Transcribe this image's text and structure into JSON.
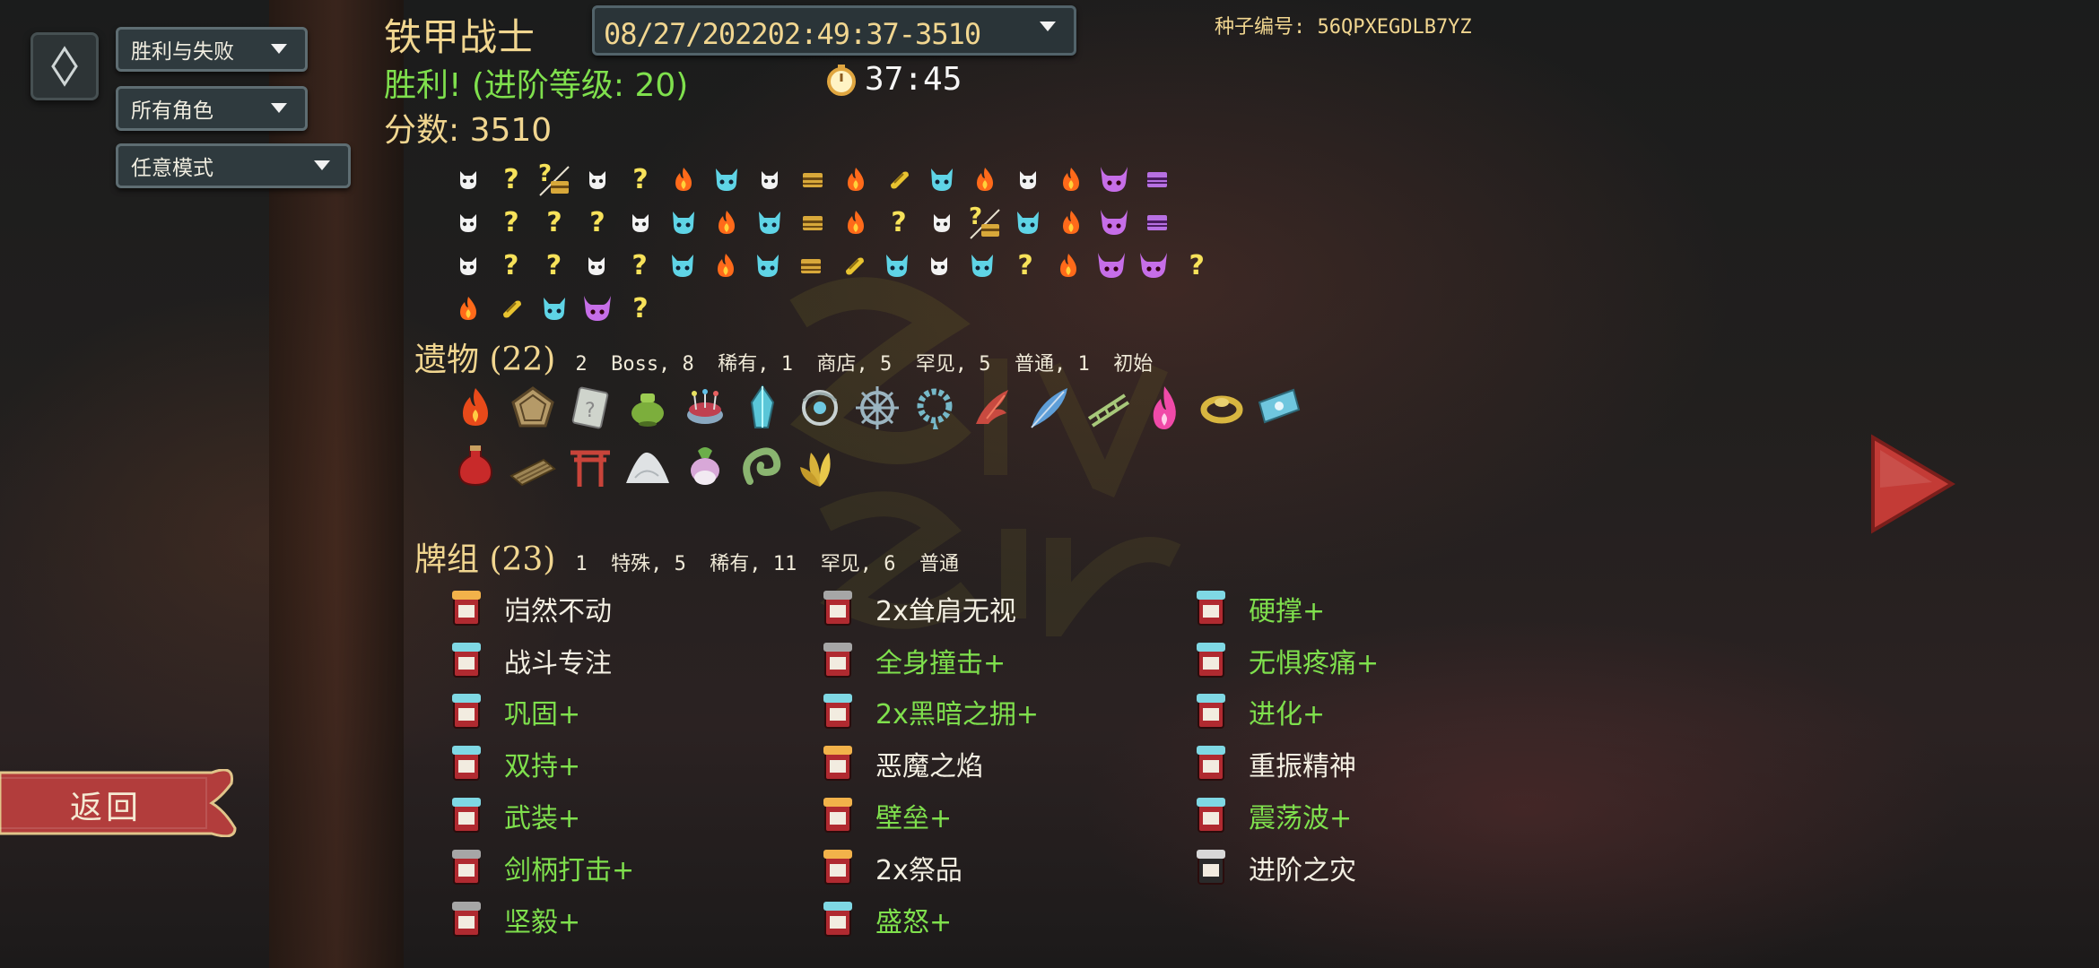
{
  "header": {
    "character": "铁甲战士",
    "run_select": "08/27/202202:49:37-3510",
    "seed": "种子编号: 56QPXEGDLB7YZ",
    "result": "胜利! (进阶等级: 20)",
    "time": "37:45",
    "score": "分数: 3510"
  },
  "filters": {
    "outcome": "胜利与失败",
    "character": "所有角色",
    "mode": "任意模式"
  },
  "back_label": "返回",
  "path": [
    [
      "monster",
      "question",
      "question-chest",
      "monster",
      "question",
      "rest",
      "elite",
      "monster",
      "shop",
      "rest",
      "treasure",
      "elite",
      "rest",
      "monster",
      "rest",
      "boss",
      "chest"
    ],
    [
      "monster",
      "question",
      "question",
      "question",
      "monster",
      "elite",
      "rest",
      "elite",
      "shop",
      "rest",
      "question",
      "monster",
      "question-chest",
      "elite",
      "rest",
      "boss",
      "chest"
    ],
    [
      "monster",
      "question",
      "question",
      "monster",
      "question",
      "elite",
      "rest",
      "elite",
      "shop",
      "treasure",
      "elite",
      "monster",
      "elite",
      "question",
      "rest",
      "boss",
      "boss",
      "question"
    ],
    [
      "rest",
      "treasure",
      "elite",
      "boss",
      "question"
    ]
  ],
  "relics": {
    "title": "遗物 (22)",
    "summary": "2  Boss, 8  稀有, 1  商店, 5  罕见, 5  普通, 1  初始",
    "row1": [
      "burning-blood",
      "pentagon-relic",
      "question-card",
      "green-pot",
      "pincushion",
      "blue-crystal",
      "orb-swirl",
      "ship-wheel",
      "prayer-beads",
      "red-claw",
      "blue-feather",
      "green-ladder",
      "pink-flame",
      "gold-ring",
      "blue-ticket"
    ],
    "row2": [
      "red-potion",
      "wooden-board",
      "torii-gate",
      "salt-pile",
      "turnip",
      "green-snake",
      "golden-leaves"
    ]
  },
  "deck": {
    "title": "牌组 (23)",
    "summary": "1  特殊, 5  稀有, 11  罕见, 6  普通",
    "columns": [
      [
        {
          "name": "岿然不动",
          "upgraded": false,
          "icon": "orange"
        },
        {
          "name": "战斗专注",
          "upgraded": false,
          "icon": "blue"
        },
        {
          "name": "巩固+",
          "upgraded": true,
          "icon": "blue"
        },
        {
          "name": "双持+",
          "upgraded": true,
          "icon": "blue"
        },
        {
          "name": "武装+",
          "upgraded": true,
          "icon": "blue"
        },
        {
          "name": "剑柄打击+",
          "upgraded": true,
          "icon": "gray"
        },
        {
          "name": "坚毅+",
          "upgraded": true,
          "icon": "gray"
        }
      ],
      [
        {
          "name": "2x耸肩无视",
          "upgraded": false,
          "icon": "gray"
        },
        {
          "name": "全身撞击+",
          "upgraded": true,
          "icon": "gray"
        },
        {
          "name": "2x黑暗之拥+",
          "upgraded": true,
          "icon": "blue"
        },
        {
          "name": "恶魔之焰",
          "upgraded": false,
          "icon": "orange"
        },
        {
          "name": "壁垒+",
          "upgraded": true,
          "icon": "orange"
        },
        {
          "name": "2x祭品",
          "upgraded": false,
          "icon": "orange"
        },
        {
          "name": "盛怒+",
          "upgraded": true,
          "icon": "blue"
        }
      ],
      [
        {
          "name": "硬撑+",
          "upgraded": true,
          "icon": "blue"
        },
        {
          "name": "无惧疼痛+",
          "upgraded": true,
          "icon": "blue"
        },
        {
          "name": "进化+",
          "upgraded": true,
          "icon": "blue"
        },
        {
          "name": "重振精神",
          "upgraded": false,
          "icon": "blue"
        },
        {
          "name": "震荡波+",
          "upgraded": true,
          "icon": "blue"
        },
        {
          "name": "进阶之灾",
          "upgraded": false,
          "icon": "dark"
        }
      ]
    ]
  },
  "colors": {
    "gold": "#f1d690",
    "upgraded_green": "#7fe04d",
    "question_yellow": "#f7e25a",
    "elite_cyan": "#5fd4e6",
    "boss_purple": "#c66ee8",
    "rest_orange": "#ff6a1a"
  }
}
